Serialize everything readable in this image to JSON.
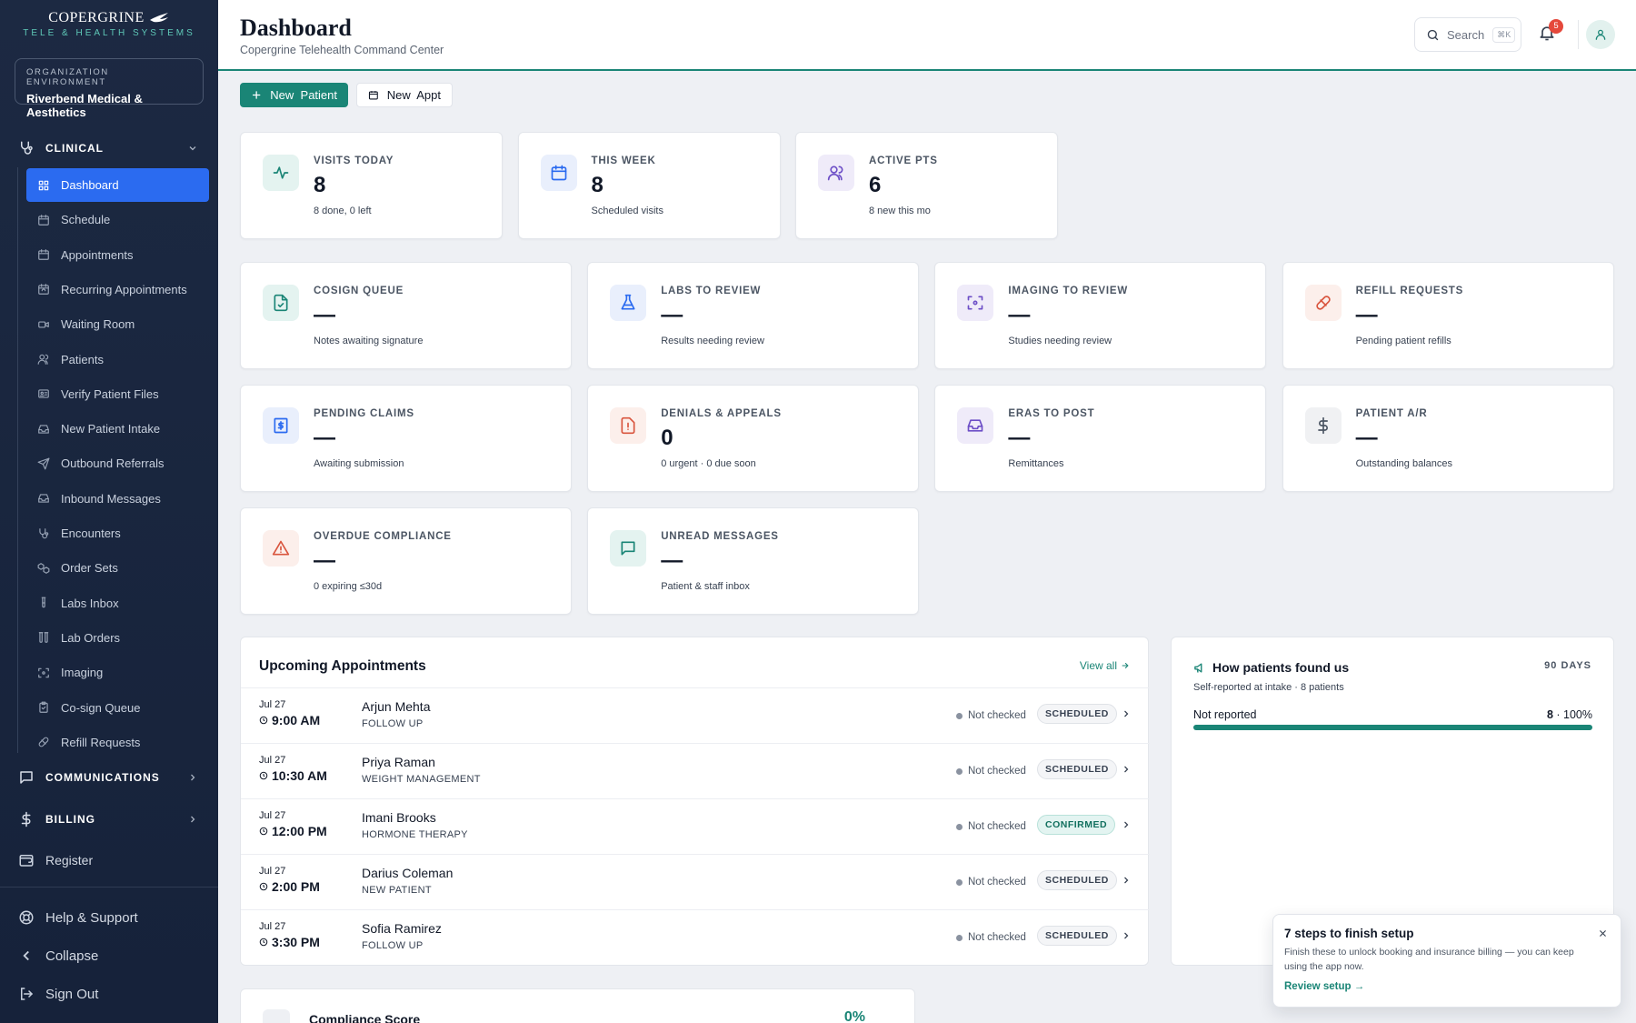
{
  "brand": {
    "name": "COPERGRINE",
    "tagline": "TELE & HEALTH SYSTEMS"
  },
  "org": {
    "label": "ORGANIZATION ENVIRONMENT",
    "name": "Riverbend Medical & Aesthetics"
  },
  "sidebar": {
    "clinical": {
      "label": "CLINICAL",
      "icon": "stethoscope-icon"
    },
    "items": [
      {
        "label": "Dashboard",
        "icon": "grid-icon",
        "active": true
      },
      {
        "label": "Schedule",
        "icon": "calendar-icon"
      },
      {
        "label": "Appointments",
        "icon": "calendar-icon"
      },
      {
        "label": "Recurring Appointments",
        "icon": "calendar-repeat-icon"
      },
      {
        "label": "Waiting Room",
        "icon": "video-icon"
      },
      {
        "label": "Patients",
        "icon": "users-icon"
      },
      {
        "label": "Verify Patient Files",
        "icon": "id-card-icon"
      },
      {
        "label": "New Patient Intake",
        "icon": "inbox-icon"
      },
      {
        "label": "Outbound Referrals",
        "icon": "send-icon"
      },
      {
        "label": "Inbound Messages",
        "icon": "inbox-tray-icon"
      },
      {
        "label": "Encounters",
        "icon": "stethoscope-icon"
      },
      {
        "label": "Order Sets",
        "icon": "boxes-icon"
      },
      {
        "label": "Labs Inbox",
        "icon": "test-tube-icon"
      },
      {
        "label": "Lab Orders",
        "icon": "test-tubes-icon"
      },
      {
        "label": "Imaging",
        "icon": "scan-icon"
      },
      {
        "label": "Co-sign Queue",
        "icon": "clipboard-check-icon"
      },
      {
        "label": "Refill Requests",
        "icon": "pill-icon"
      }
    ],
    "communications": {
      "label": "COMMUNICATIONS",
      "icon": "message-square-icon"
    },
    "billing": {
      "label": "BILLING",
      "icon": "dollar-icon"
    },
    "register": {
      "label": "Register",
      "icon": "wallet-icon"
    },
    "help": {
      "label": "Help & Support",
      "icon": "life-buoy-icon"
    },
    "collapse": {
      "label": "Collapse",
      "icon": "chevron-left-icon"
    },
    "signout": {
      "label": "Sign Out",
      "icon": "log-out-icon"
    }
  },
  "header": {
    "title": "Dashboard",
    "subtitle": "Copergrine Telehealth Command Center",
    "search_label": "Search",
    "search_shortcut": "⌘K",
    "notifications_count": "5"
  },
  "actions": {
    "new_patient": "New  Patient",
    "new_appt": "New  Appt"
  },
  "stats": [
    {
      "label": "VISITS TODAY",
      "value": "8",
      "note": "8 done, 0 left",
      "icon": "activity-icon",
      "color": "#1a8576",
      "bg": "#e4f3f0"
    },
    {
      "label": "THIS WEEK",
      "value": "8",
      "note": "Scheduled visits",
      "icon": "calendar-icon",
      "color": "#2b6bf0",
      "bg": "#e9effc"
    },
    {
      "label": "ACTIVE PTS",
      "value": "6",
      "note": "8 new this mo",
      "icon": "users-icon",
      "color": "#6d4fc7",
      "bg": "#efebf9"
    }
  ],
  "metrics": [
    {
      "label": "COSIGN QUEUE",
      "value": "—",
      "note": "Notes awaiting signature",
      "icon": "file-check-icon",
      "color": "#1a8576",
      "bg": "#e4f3f0"
    },
    {
      "label": "LABS TO REVIEW",
      "value": "—",
      "note": "Results needing review",
      "icon": "flask-icon",
      "color": "#2b6bf0",
      "bg": "#e9effc"
    },
    {
      "label": "IMAGING TO REVIEW",
      "value": "—",
      "note": "Studies needing review",
      "icon": "scan-icon",
      "color": "#6d4fc7",
      "bg": "#efebf9"
    },
    {
      "label": "REFILL REQUESTS",
      "value": "—",
      "note": "Pending patient refills",
      "icon": "pill-icon",
      "color": "#d9553e",
      "bg": "#fcefeb"
    },
    {
      "label": "PENDING CLAIMS",
      "value": "—",
      "note": "Awaiting submission",
      "icon": "receipt-icon",
      "color": "#2b6bf0",
      "bg": "#e9effc"
    },
    {
      "label": "DENIALS & APPEALS",
      "value": "0",
      "note": "0 urgent · 0 due soon",
      "icon": "file-alert-icon",
      "color": "#d9553e",
      "bg": "#fcefeb"
    },
    {
      "label": "ERAS TO POST",
      "value": "—",
      "note": "Remittances",
      "icon": "inbox-tray-icon",
      "color": "#6d4fc7",
      "bg": "#efebf9"
    },
    {
      "label": "PATIENT A/R",
      "value": "—",
      "note": "Outstanding balances",
      "icon": "dollar-icon",
      "color": "#4b5563",
      "bg": "#f0f1f3"
    },
    {
      "label": "OVERDUE COMPLIANCE",
      "value": "—",
      "note": "0 expiring ≤30d",
      "icon": "alert-triangle-icon",
      "color": "#d9553e",
      "bg": "#fcefeb"
    },
    {
      "label": "UNREAD MESSAGES",
      "value": "—",
      "note": "Patient & staff inbox",
      "icon": "message-square-icon",
      "color": "#1a8576",
      "bg": "#e4f3f0"
    }
  ],
  "upcoming": {
    "title": "Upcoming Appointments",
    "view_all": "View all",
    "rows": [
      {
        "date": "Jul 27",
        "time": "9:00 AM",
        "name": "Arjun Mehta",
        "type": "FOLLOW UP",
        "check": "Not checked",
        "status": "SCHEDULED"
      },
      {
        "date": "Jul 27",
        "time": "10:30 AM",
        "name": "Priya Raman",
        "type": "WEIGHT MANAGEMENT",
        "check": "Not checked",
        "status": "SCHEDULED"
      },
      {
        "date": "Jul 27",
        "time": "12:00 PM",
        "name": "Imani Brooks",
        "type": "HORMONE THERAPY",
        "check": "Not checked",
        "status": "CONFIRMED"
      },
      {
        "date": "Jul 27",
        "time": "2:00 PM",
        "name": "Darius Coleman",
        "type": "NEW PATIENT",
        "check": "Not checked",
        "status": "SCHEDULED"
      },
      {
        "date": "Jul 27",
        "time": "3:30 PM",
        "name": "Sofia Ramirez",
        "type": "FOLLOW UP",
        "check": "Not checked",
        "status": "SCHEDULED"
      }
    ]
  },
  "found_us": {
    "title": "How patients found us",
    "days": "90 DAYS",
    "subtitle": "Self-reported at intake · 8 patients",
    "source": "Not reported",
    "count": "8",
    "percent_label": "100%",
    "share": 1.0
  },
  "setup_toast": {
    "title": "7 steps to finish setup",
    "description": "Finish these to unlock booking and insurance billing — you can keep using the app now.",
    "link": "Review setup →"
  },
  "compliance": {
    "title": "Compliance Score",
    "value": "0%"
  }
}
